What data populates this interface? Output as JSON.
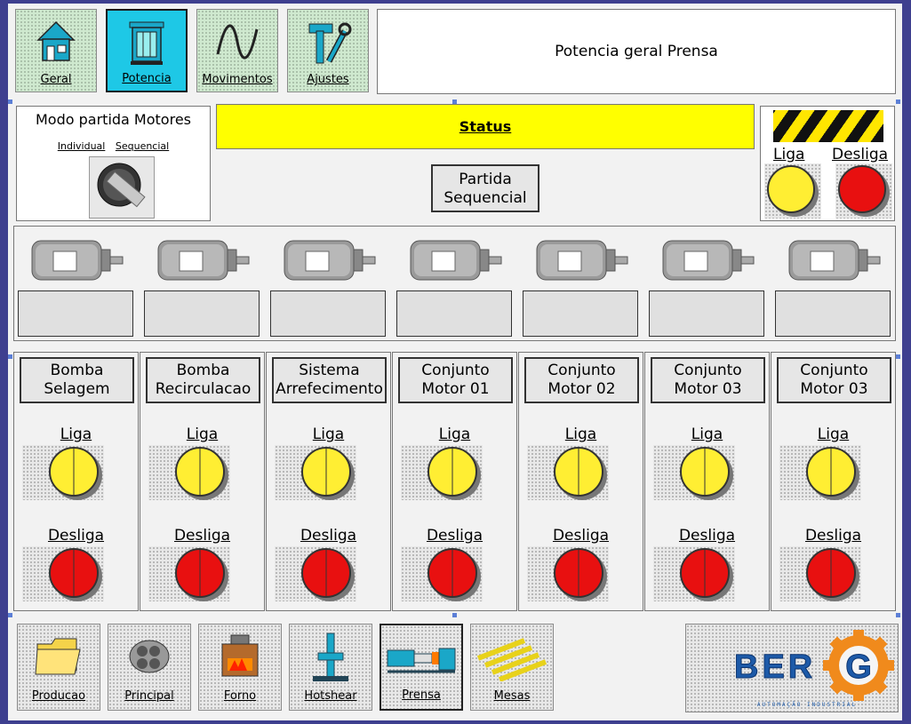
{
  "top_nav": [
    {
      "label": "Geral",
      "icon": "house-icon",
      "active": false
    },
    {
      "label": "Potencia",
      "icon": "cabinet-icon",
      "active": true
    },
    {
      "label": "Movimentos",
      "icon": "sine-wave-icon",
      "active": false
    },
    {
      "label": "Ajustes",
      "icon": "tools-icon",
      "active": false
    }
  ],
  "screen_title": "Potencia geral Prensa",
  "modo": {
    "title": "Modo partida Motores",
    "option_individual": "Individual",
    "option_sequencial": "Sequencial"
  },
  "status": {
    "label": "Status"
  },
  "partida": {
    "line1": "Partida",
    "line2": "Sequencial"
  },
  "master": {
    "liga": "Liga",
    "desliga": "Desliga"
  },
  "columns": [
    {
      "line1": "Bomba",
      "line2": "Selagem",
      "liga": "Liga",
      "desliga": "Desliga"
    },
    {
      "line1": "Bomba",
      "line2": "Recirculacao",
      "liga": "Liga",
      "desliga": "Desliga"
    },
    {
      "line1": "Sistema",
      "line2": "Arrefecimento",
      "liga": "Liga",
      "desliga": "Desliga"
    },
    {
      "line1": "Conjunto",
      "line2": "Motor 01",
      "liga": "Liga",
      "desliga": "Desliga"
    },
    {
      "line1": "Conjunto",
      "line2": "Motor 02",
      "liga": "Liga",
      "desliga": "Desliga"
    },
    {
      "line1": "Conjunto",
      "line2": "Motor 03",
      "liga": "Liga",
      "desliga": "Desliga"
    },
    {
      "line1": "Conjunto",
      "line2": "Motor 03",
      "liga": "Liga",
      "desliga": "Desliga"
    }
  ],
  "bottom_nav": [
    {
      "label": "Producao",
      "icon": "folder-icon"
    },
    {
      "label": "Principal",
      "icon": "cable-bundle-icon"
    },
    {
      "label": "Forno",
      "icon": "furnace-icon"
    },
    {
      "label": "Hotshear",
      "icon": "hotshear-icon"
    },
    {
      "label": "Prensa",
      "icon": "press-icon"
    },
    {
      "label": "Mesas",
      "icon": "tables-icon"
    }
  ],
  "logo": {
    "brand_left": "BER",
    "brand_right": "G",
    "tagline": "AUTOMAÇÃO INDUSTRIAL"
  },
  "colors": {
    "active_nav": "#1ec8e6",
    "status_bar": "#ffff00",
    "lamp_on": "#ffee33",
    "lamp_off": "#e81010",
    "logo_blue": "#1d5aa8",
    "logo_orange": "#f08a1c"
  }
}
